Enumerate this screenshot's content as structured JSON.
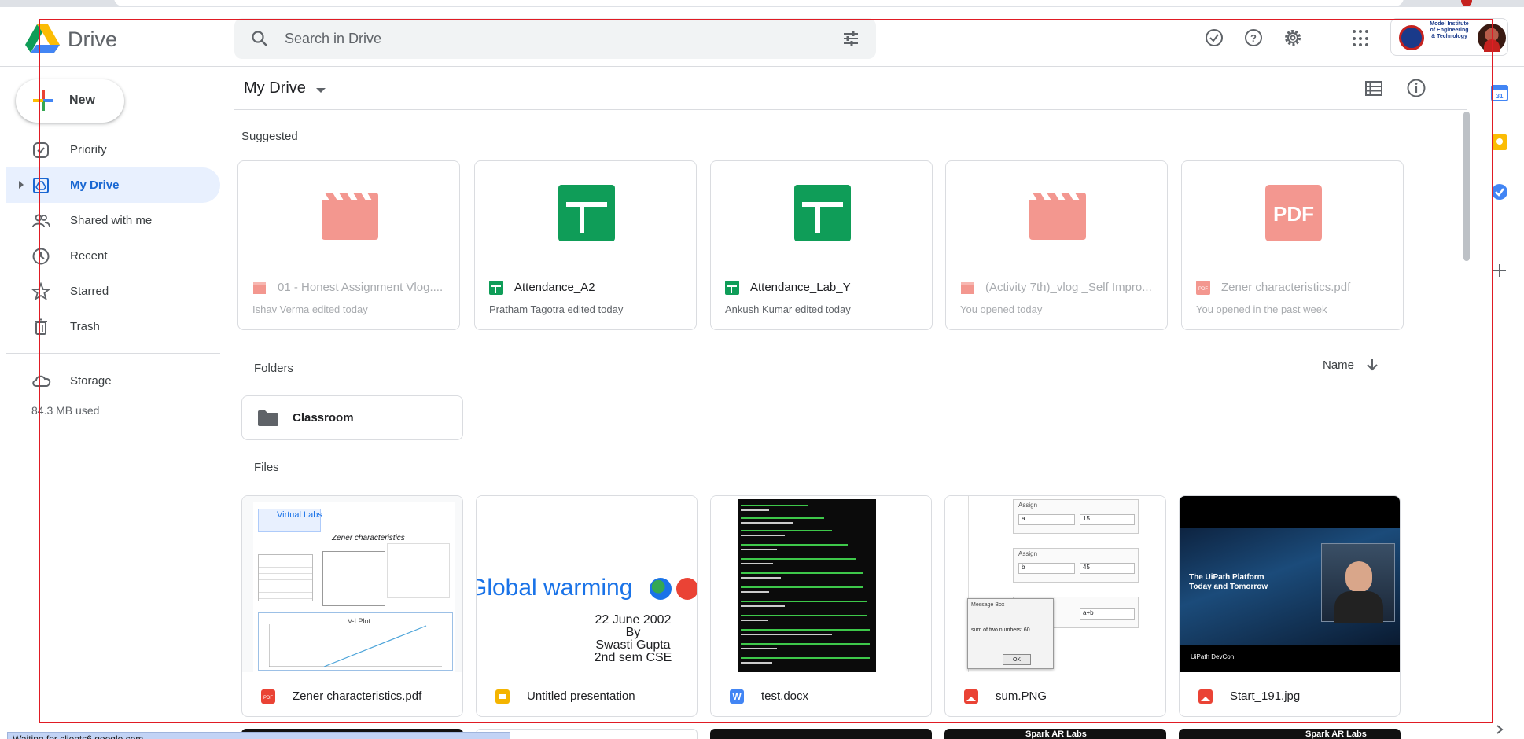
{
  "app": {
    "name": "Drive"
  },
  "search": {
    "placeholder": "Search in Drive"
  },
  "header": {
    "org_text": "Model Institute of Engineering & Technology"
  },
  "new_button": {
    "label": "New"
  },
  "sidebar": {
    "items": [
      {
        "label": "Priority",
        "icon": "priority-icon"
      },
      {
        "label": "My Drive",
        "icon": "my-drive-icon",
        "active": true
      },
      {
        "label": "Shared with me",
        "icon": "shared-icon"
      },
      {
        "label": "Recent",
        "icon": "clock-icon"
      },
      {
        "label": "Starred",
        "icon": "star-icon"
      },
      {
        "label": "Trash",
        "icon": "trash-icon"
      }
    ],
    "storage_label": "Storage",
    "storage_used": "84.3 MB used"
  },
  "main": {
    "title": "My Drive",
    "suggested_label": "Suggested",
    "folders_label": "Folders",
    "files_label": "Files",
    "sort_label": "Name"
  },
  "suggested": [
    {
      "name": "01 - Honest Assignment Vlog....",
      "sub": "Ishav Verma edited today",
      "type": "video"
    },
    {
      "name": "Attendance_A2",
      "sub": "Pratham Tagotra edited today",
      "type": "sheet"
    },
    {
      "name": "Attendance_Lab_Y",
      "sub": "Ankush Kumar edited today",
      "type": "sheet"
    },
    {
      "name": "(Activity 7th)_vlog _Self Impro...",
      "sub": "You opened today",
      "type": "video"
    },
    {
      "name": "Zener characteristics.pdf",
      "sub": "You opened in the past week",
      "type": "pdf"
    }
  ],
  "folders": [
    {
      "name": "Classroom"
    }
  ],
  "files": [
    {
      "name": "Zener characteristics.pdf",
      "type": "pdf",
      "thumb": {
        "logo": "Virtual Labs",
        "heading": "Zener characteristics",
        "plot": "V-I Plot"
      }
    },
    {
      "name": "Untitled presentation",
      "type": "slides",
      "thumb": {
        "line1": "Global warming",
        "line2": "22 June 2002",
        "line3": "By",
        "line4": "Swasti Gupta",
        "line5": "2nd sem CSE"
      }
    },
    {
      "name": "test.docx",
      "type": "doc"
    },
    {
      "name": "sum.PNG",
      "type": "image",
      "thumb": {
        "assign": "Assign",
        "v1": "a",
        "n1": "15",
        "v2": "b",
        "n2": "45",
        "v3": "a+b",
        "box_title": "Message Box",
        "box_text": "sum of two numbers: 60",
        "ok": "OK"
      }
    },
    {
      "name": "Start_191.jpg",
      "type": "image",
      "thumb": {
        "slide_title": "The UiPath Platform Today and Tomorrow",
        "footer": "UiPath DevCon"
      }
    }
  ],
  "bottom_row": {
    "spark_1": "Spark AR Labs",
    "spark_2": "Spark AR Labs"
  },
  "status_bar": {
    "text": "Waiting for clients6.google.com..."
  },
  "colors": {
    "accent": "#1967d2",
    "active_bg": "#e8f0fe",
    "sheet": "#0f9d58",
    "pdf": "#ea4335",
    "slides": "#f4b400",
    "doc": "#4285f4",
    "frame": "#e01b24"
  }
}
